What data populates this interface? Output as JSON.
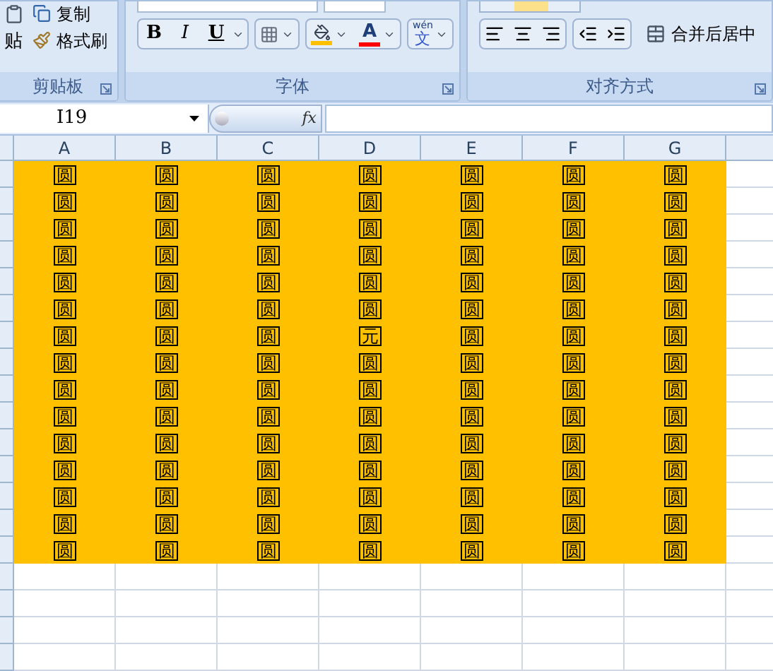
{
  "ribbon": {
    "groups": [
      {
        "kind": "clipboard",
        "label": "剪贴板",
        "paste": "贴",
        "items": [
          "复制",
          "格式刷"
        ]
      },
      {
        "kind": "font",
        "label": "字体",
        "bold": "B",
        "italic": "I",
        "underline": "U",
        "font_color": "A",
        "phonetic_top": "wén",
        "phonetic": "文"
      },
      {
        "kind": "alignment",
        "label": "对齐方式",
        "merge": "合并后居中"
      }
    ]
  },
  "name_box": {
    "value": "I19"
  },
  "formula_button": "fx",
  "sheet": {
    "columns": [
      "A",
      "B",
      "C",
      "D",
      "E",
      "F",
      "G"
    ],
    "filled_rows": [
      [
        "圆",
        "圆",
        "圆",
        "圆",
        "圆",
        "圆",
        "圆"
      ],
      [
        "圆",
        "圆",
        "圆",
        "圆",
        "圆",
        "圆",
        "圆"
      ],
      [
        "圆",
        "圆",
        "圆",
        "圆",
        "圆",
        "圆",
        "圆"
      ],
      [
        "圆",
        "圆",
        "圆",
        "圆",
        "圆",
        "圆",
        "圆"
      ],
      [
        "圆",
        "圆",
        "圆",
        "圆",
        "圆",
        "圆",
        "圆"
      ],
      [
        "圆",
        "圆",
        "圆",
        "圆",
        "圆",
        "圆",
        "圆"
      ],
      [
        "圆",
        "圆",
        "圆",
        "元",
        "圆",
        "圆",
        "圆"
      ],
      [
        "圆",
        "圆",
        "圆",
        "圆",
        "圆",
        "圆",
        "圆"
      ],
      [
        "圆",
        "圆",
        "圆",
        "圆",
        "圆",
        "圆",
        "圆"
      ],
      [
        "圆",
        "圆",
        "圆",
        "圆",
        "圆",
        "圆",
        "圆"
      ],
      [
        "圆",
        "圆",
        "圆",
        "圆",
        "圆",
        "圆",
        "圆"
      ],
      [
        "圆",
        "圆",
        "圆",
        "圆",
        "圆",
        "圆",
        "圆"
      ],
      [
        "圆",
        "圆",
        "圆",
        "圆",
        "圆",
        "圆",
        "圆"
      ],
      [
        "圆",
        "圆",
        "圆",
        "圆",
        "圆",
        "圆",
        "圆"
      ],
      [
        "圆",
        "圆",
        "圆",
        "圆",
        "圆",
        "圆",
        "圆"
      ]
    ]
  }
}
